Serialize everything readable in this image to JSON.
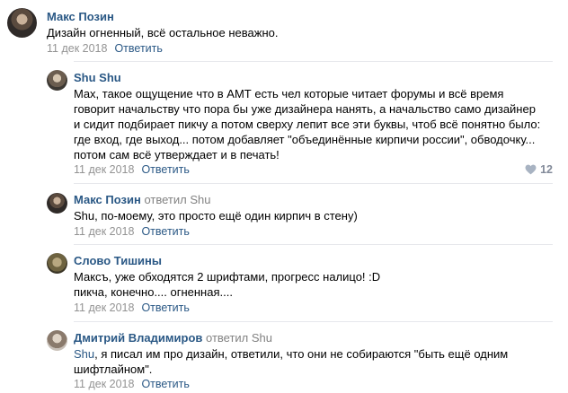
{
  "comments": [
    {
      "author": "Макс Позин",
      "text": "Дизайн огненный, всё остальное неважно.",
      "date": "11 дек 2018",
      "reply_label": "Ответить"
    },
    {
      "author": "Shu Shu",
      "text": "Max, такое ощущение что в АМТ есть чел которые читает форумы и всё время\nговорит начальству что пора бы уже дизайнера нанять, а начальство само дизайнер\nи сидит подбирает пикчу а потом сверху лепит все эти буквы, чтоб всё понятно было:\nгде вход, где выход... потом добавляет \"объединённые кирпичи россии\", обводочку...\nпотом сам всё утверждает и в печать!",
      "date": "11 дек 2018",
      "reply_label": "Ответить",
      "likes": "12"
    },
    {
      "author": "Макс Позин",
      "replied_label": "ответил",
      "replied_to": "Shu",
      "text": "Shu, по-моему, это просто ещё один кирпич в стену)",
      "date": "11 дек 2018",
      "reply_label": "Ответить"
    },
    {
      "author": "Слово Тишины",
      "text": "Максъ, уже обходятся 2 шрифтами, прогресс налицо! :D\nпикча, конечно.... огненная....",
      "date": "11 дек 2018",
      "reply_label": "Ответить"
    },
    {
      "author": "Дмитрий Владимиров",
      "replied_label": "ответил",
      "replied_to": "Shu",
      "mention": "Shu",
      "text": ", я писал им про дизайн, ответили, что они не собираются \"быть ещё одним\nшифтлайном\".",
      "date": "11 дек 2018",
      "reply_label": "Ответить"
    }
  ],
  "colors": {
    "link": "#2a5885",
    "meta": "#939393",
    "separator": "#e7e8ec"
  },
  "icons": {
    "like": "heart-icon"
  }
}
